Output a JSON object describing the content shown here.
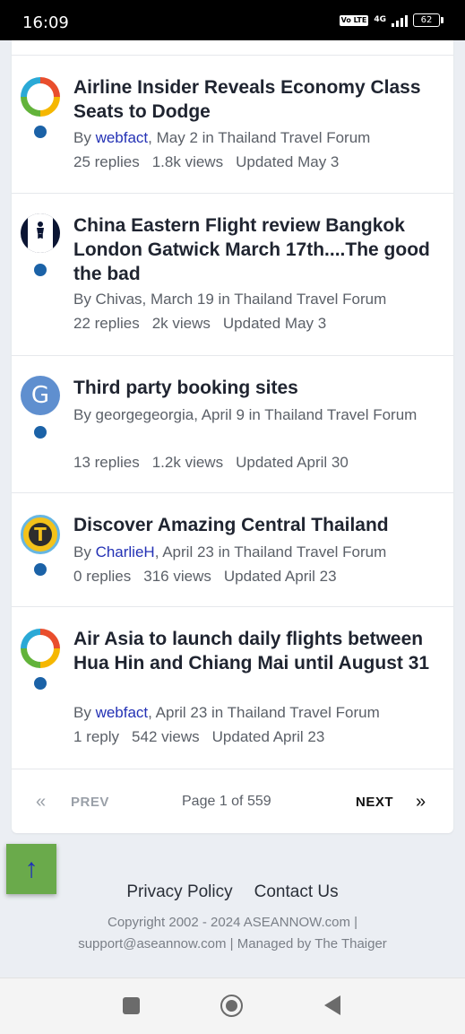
{
  "status_bar": {
    "time": "16:09",
    "volte": "Vo LTE",
    "network": "4G",
    "battery": "62"
  },
  "topics": [
    {
      "title": "Airline Insider Reveals Economy Class Seats to Dodge",
      "by": "By ",
      "author": "webfact",
      "meta_rest": ", May 2 in Thailand Travel Forum",
      "replies": "25 replies",
      "views": "1.8k views",
      "updated": "Updated May 3"
    },
    {
      "title": "China Eastern Flight review Bangkok London Gatwick March 17th....The good the bad",
      "meta": "By Chivas, March 19 in Thailand Travel Forum",
      "replies": "22 replies",
      "views": "2k views",
      "updated": "Updated May 3"
    },
    {
      "title": "Third party booking sites",
      "avatar_letter": "G",
      "meta": "By georgegeorgia, April 9 in Thailand Travel Forum",
      "replies": "13 replies",
      "views": "1.2k views",
      "updated": "Updated April 30"
    },
    {
      "title": "Discover Amazing Central Thailand",
      "avatar_letter": "T",
      "by": "By ",
      "author": "CharlieH",
      "meta_rest": ", April 23 in Thailand Travel Forum",
      "replies": "0 replies",
      "views": "316 views",
      "updated": "Updated April 23"
    },
    {
      "title": "Air Asia to launch daily flights between Hua Hin and Chiang Mai until August 31",
      "by": "By ",
      "author": "webfact",
      "meta_rest": ", April 23 in Thailand Travel Forum",
      "replies": "1 reply",
      "views": "542 views",
      "updated": "Updated April 23"
    }
  ],
  "pagination": {
    "prev_icon": "«",
    "prev": "PREV",
    "page": "Page 1 of 559",
    "next": "NEXT",
    "next_icon": "»"
  },
  "back_to_top": "↑",
  "footer": {
    "privacy": "Privacy Policy",
    "contact": "Contact Us",
    "copyright": "Copyright 2002 - 2024 ASEANNOW.com | support@aseannow.com | Managed by The Thaiger"
  },
  "colors": {
    "accent_link": "#2432b5",
    "unread_dot": "#1b62a7",
    "back_to_top_bg": "#6aaa4b"
  }
}
